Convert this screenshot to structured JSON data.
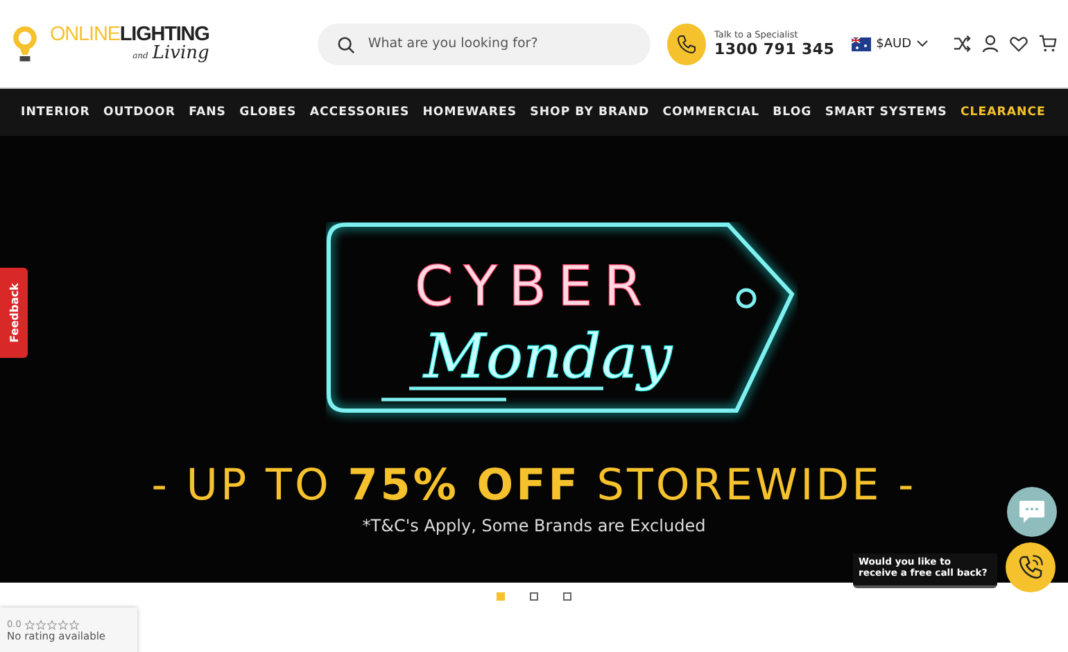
{
  "logo": {
    "word_light": "ONLINE",
    "word_bold": "LIGHTING",
    "tagline_small": "and",
    "tagline": "Living"
  },
  "search": {
    "placeholder": "What are you looking for?"
  },
  "contact": {
    "caption": "Talk to a Specialist",
    "phone": "1300 791 345"
  },
  "currency": {
    "label": "$AUD"
  },
  "nav": [
    {
      "label": "INTERIOR",
      "highlight": false
    },
    {
      "label": "OUTDOOR",
      "highlight": false
    },
    {
      "label": "FANS",
      "highlight": false
    },
    {
      "label": "GLOBES",
      "highlight": false
    },
    {
      "label": "ACCESSORIES",
      "highlight": false
    },
    {
      "label": "HOMEWARES",
      "highlight": false
    },
    {
      "label": "SHOP BY BRAND",
      "highlight": false
    },
    {
      "label": "COMMERCIAL",
      "highlight": false
    },
    {
      "label": "BLOG",
      "highlight": false
    },
    {
      "label": "SMART SYSTEMS",
      "highlight": false
    },
    {
      "label": "CLEARANCE",
      "highlight": true
    }
  ],
  "banner": {
    "neon_top": "CYBER",
    "neon_script": "Monday",
    "headline": "- UP TO **75% OFF** STOREWIDE -",
    "note": "*T&C's Apply, Some Brands are Excluded"
  },
  "carousel_dots": [
    {
      "selected": true
    },
    {
      "selected": false
    },
    {
      "selected": false
    }
  ],
  "feedback_tab": "Feedback",
  "callback": {
    "prompt": "Would you like to receive a free call back?"
  },
  "rating": {
    "score": "0.0",
    "stars": 0,
    "text": "No rating available"
  }
}
